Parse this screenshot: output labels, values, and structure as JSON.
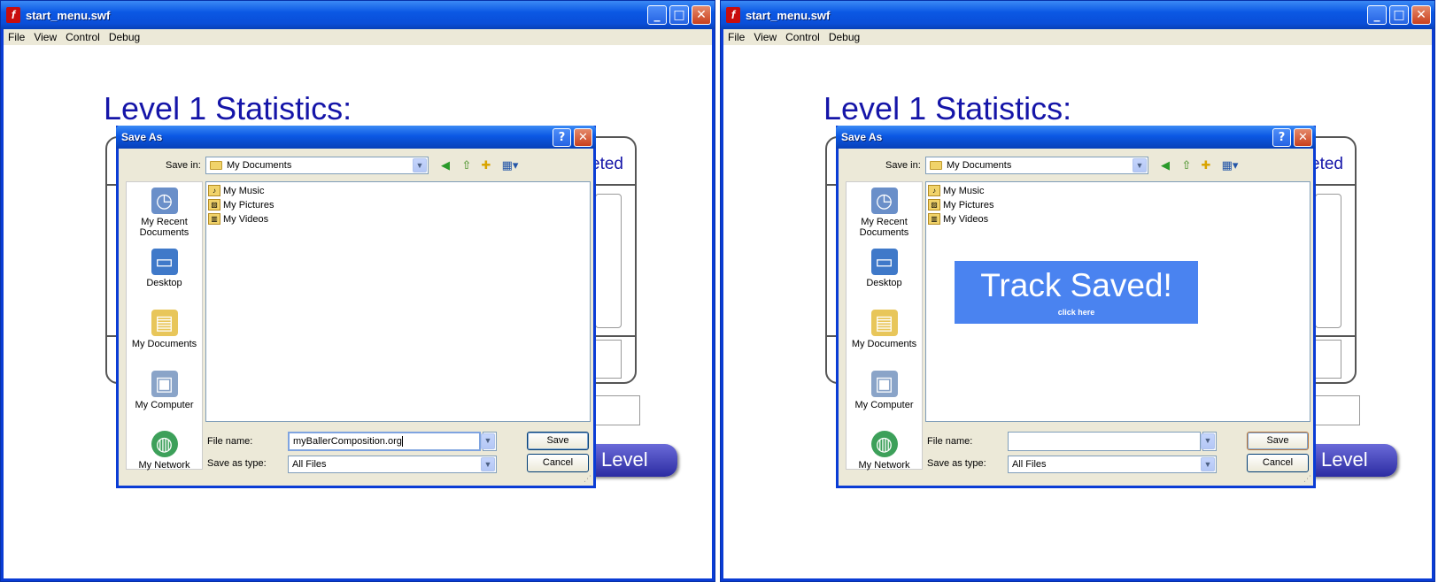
{
  "window": {
    "title": "start_menu.swf",
    "app_icon": "flash-player-icon",
    "min": "_",
    "max": "□",
    "close": "✕"
  },
  "menu": [
    "File",
    "View",
    "Control",
    "Debug"
  ],
  "game": {
    "stats_title": "Level 1 Statistics:",
    "peek_text": "eted",
    "level_button": "Level"
  },
  "dialog": {
    "title": "Save As",
    "help": "?",
    "close": "✕",
    "save_in_label": "Save in:",
    "save_in_value": "My Documents",
    "places": [
      {
        "label": "My Recent Documents",
        "icon": "recent-documents-icon"
      },
      {
        "label": "Desktop",
        "icon": "desktop-icon"
      },
      {
        "label": "My Documents",
        "icon": "my-documents-icon"
      },
      {
        "label": "My Computer",
        "icon": "my-computer-icon"
      },
      {
        "label": "My Network",
        "icon": "my-network-icon"
      }
    ],
    "files": [
      "My Music",
      "My Pictures",
      "My Videos"
    ],
    "file_name_label": "File name:",
    "save_type_label": "Save as type:",
    "save_type_value": "All Files",
    "save_button": "Save",
    "cancel_button": "Cancel"
  },
  "left": {
    "file_name_value": "myBallerComposition.org"
  },
  "right": {
    "file_name_value": "",
    "toast_title": "Track Saved!",
    "toast_sub": "click here"
  }
}
